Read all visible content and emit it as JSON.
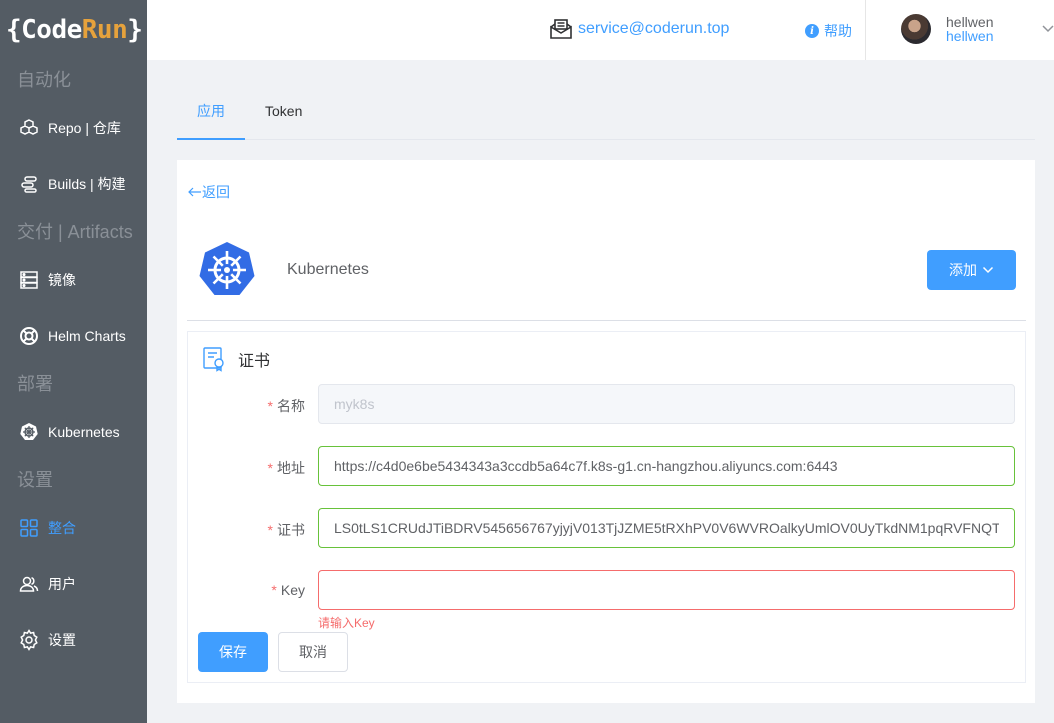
{
  "logo": {
    "open": "{",
    "code": "Code",
    "run": "Run",
    "close": "}"
  },
  "sidebar": {
    "groups": [
      "自动化",
      "交付 | Artifacts",
      "部署",
      "设置"
    ],
    "items": [
      {
        "label": "Repo | 仓库",
        "icon": "cubes-icon"
      },
      {
        "label": "Builds | 构建",
        "icon": "pipeline-icon"
      },
      {
        "label": "镜像",
        "icon": "server-icon"
      },
      {
        "label": "Helm Charts",
        "icon": "lifebuoy-icon"
      },
      {
        "label": "Kubernetes",
        "icon": "kubernetes-icon"
      },
      {
        "label": "整合",
        "icon": "grid-icon",
        "active": true
      },
      {
        "label": "用户",
        "icon": "users-icon"
      },
      {
        "label": "设置",
        "icon": "gear-icon"
      }
    ]
  },
  "header": {
    "email": "service@coderun.top",
    "help": "帮助",
    "user_name": "hellwen",
    "user_login": "hellwen"
  },
  "tabs": [
    {
      "label": "应用",
      "active": true
    },
    {
      "label": "Token",
      "active": false
    }
  ],
  "card": {
    "back": "返回",
    "title": "Kubernetes",
    "add_button": "添加",
    "section_title": "证书",
    "form": {
      "name_label": "名称",
      "name_value": "myk8s",
      "address_label": "地址",
      "address_value": "https://c4d0e6be5434343a3ccdb5a64c7f.k8s-g1.cn-hangzhou.aliyuncs.com:6443",
      "cert_label": "证书",
      "cert_value": "LS0tLS1CRUdJTiBDRV545656767yjyjV013TjJZME5tRXhPV0V6WVROalkyUmlOV0UyTkdNM1pqRVFNQT",
      "key_label": "Key",
      "key_value": "",
      "key_error": "请输入Key",
      "required_mark": "*"
    },
    "save_button": "保存",
    "cancel_button": "取消"
  },
  "colors": {
    "primary": "#409eff",
    "sidebar_bg": "#545c64",
    "success": "#67c23a",
    "danger": "#f56c6c",
    "brand_accent": "#e6a23c"
  }
}
